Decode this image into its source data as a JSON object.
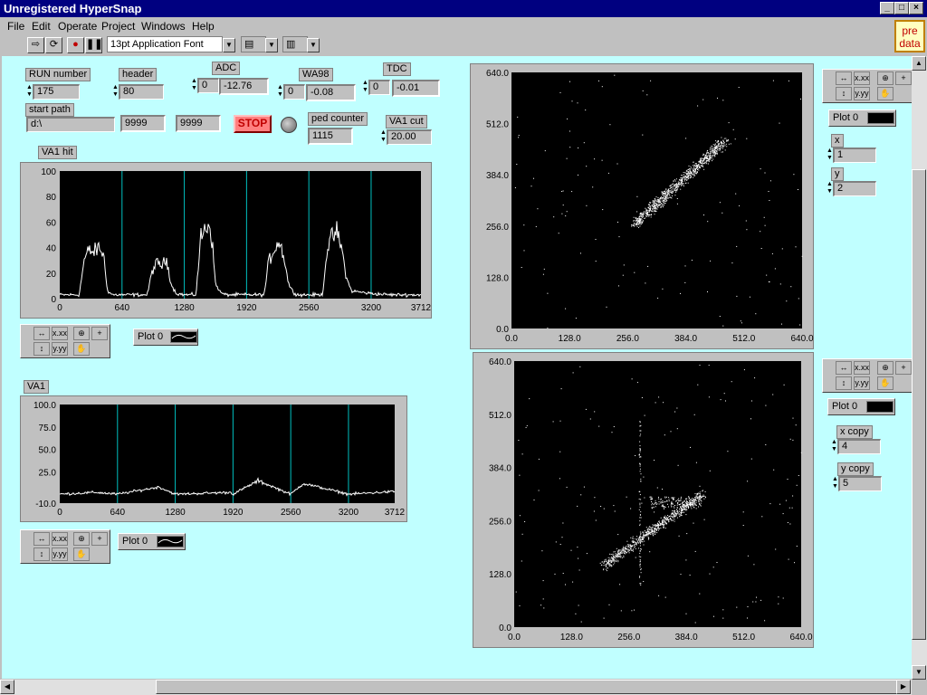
{
  "window": {
    "title": "Unregistered HyperSnap"
  },
  "menu": [
    "File",
    "Edit",
    "Operate",
    "Project",
    "Windows",
    "Help"
  ],
  "toolbar": {
    "font": "13pt Application Font"
  },
  "predata": "pre data",
  "controls": {
    "run_number": {
      "label": "RUN number",
      "value": "175"
    },
    "header": {
      "label": "header",
      "value": "80"
    },
    "adc": {
      "label": "ADC",
      "ctrl": "0",
      "value": "-12.76"
    },
    "wa98": {
      "label": "WA98",
      "ctrl": "0",
      "value": "-0.08"
    },
    "tdc": {
      "label": "TDC",
      "ctrl": "0",
      "value": "-0.01"
    },
    "start_path": {
      "label": "start path",
      "value": "d:\\",
      "f1": "9999",
      "f2": "9999"
    },
    "stop": "STOP",
    "ped_counter": {
      "label": "ped counter",
      "value": "1115"
    },
    "va1_cut": {
      "label": "VA1 cut",
      "value": "20.00"
    },
    "x": {
      "label": "x",
      "value": "1"
    },
    "y": {
      "label": "y",
      "value": "2"
    },
    "x_copy": {
      "label": "x copy",
      "value": "4"
    },
    "y_copy": {
      "label": "y copy",
      "value": "5"
    }
  },
  "legend": {
    "plot0": "Plot 0"
  },
  "palette": {
    "fmt1": "x.xx",
    "fmt2": "y.yy"
  },
  "colors": {
    "panel": "#c0ffff",
    "plot_bg": "#000000",
    "trace": "#ffffff",
    "cursor": "#00c0c0",
    "title_bar": "#000080"
  },
  "chart_data": [
    {
      "type": "line",
      "title": "VA1 hit",
      "xlim": [
        0,
        3712
      ],
      "ylim": [
        0,
        100
      ],
      "x_ticks": [
        "0",
        "640",
        "1280",
        "1920",
        "2560",
        "3200",
        "3712"
      ],
      "y_ticks": [
        "100",
        "80",
        "60",
        "40",
        "20",
        "0"
      ],
      "cursors_x": [
        640,
        1280,
        1920,
        2560,
        3200
      ],
      "series": [
        {
          "x": [
            0,
            200,
            250,
            300,
            350,
            400,
            450,
            480,
            500,
            550,
            640,
            700,
            900,
            950,
            1000,
            1050,
            1100,
            1150,
            1200,
            1280,
            1400,
            1450,
            1500,
            1530,
            1560,
            1600,
            1650,
            1700,
            1800,
            1920,
            2100,
            2150,
            2200,
            2250,
            2300,
            2350,
            2400,
            2450,
            2500,
            2560,
            2700,
            2750,
            2800,
            2850,
            2900,
            2950,
            3000,
            3100,
            3200,
            3400,
            3712
          ],
          "y": [
            3,
            3,
            30,
            38,
            36,
            40,
            35,
            12,
            5,
            3,
            3,
            3,
            3,
            22,
            28,
            26,
            30,
            10,
            4,
            3,
            3,
            48,
            55,
            60,
            50,
            12,
            5,
            3,
            3,
            3,
            3,
            30,
            38,
            45,
            35,
            12,
            5,
            3,
            3,
            3,
            3,
            40,
            48,
            52,
            38,
            15,
            6,
            5,
            4,
            3,
            3
          ]
        }
      ]
    },
    {
      "type": "line",
      "title": "VA1",
      "xlim": [
        0,
        3712
      ],
      "ylim": [
        -10,
        100
      ],
      "x_ticks": [
        "0",
        "640",
        "1280",
        "1920",
        "2560",
        "3200",
        "3712"
      ],
      "y_ticks": [
        "100.0",
        "75.0",
        "50.0",
        "25.0",
        "-10.0"
      ],
      "cursors_x": [
        640,
        1280,
        1920,
        2560,
        3200
      ],
      "series": [
        {
          "x": [
            0,
            400,
            640,
            1100,
            1280,
            1900,
            1920,
            2200,
            2560,
            2700,
            3200,
            3712
          ],
          "y": [
            0,
            2,
            0,
            8,
            0,
            2,
            0,
            15,
            0,
            12,
            0,
            3
          ]
        }
      ]
    },
    {
      "type": "scatter",
      "xlim": [
        0,
        640
      ],
      "ylim": [
        0,
        640
      ],
      "x_ticks": [
        "0.0",
        "128.0",
        "256.0",
        "384.0",
        "512.0",
        "640.0"
      ],
      "y_ticks": [
        "640.0",
        "512.0",
        "384.0",
        "256.0",
        "128.0",
        "0.0"
      ],
      "cluster": {
        "from": [
          270,
          260
        ],
        "to": [
          470,
          470
        ],
        "spread": 18
      }
    },
    {
      "type": "scatter",
      "xlim": [
        0,
        640
      ],
      "ylim": [
        0,
        640
      ],
      "x_ticks": [
        "0.0",
        "128.0",
        "256.0",
        "384.0",
        "512.0",
        "640.0"
      ],
      "y_ticks": [
        "640.0",
        "512.0",
        "384.0",
        "256.0",
        "128.0",
        "0.0"
      ],
      "cluster": {
        "from": [
          200,
          150
        ],
        "to": [
          420,
          320
        ],
        "spread": 16
      }
    }
  ]
}
